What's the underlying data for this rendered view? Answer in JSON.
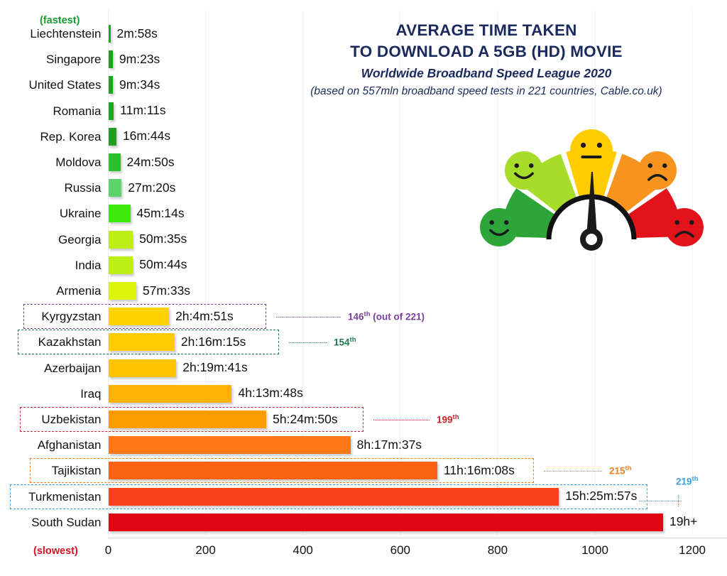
{
  "header": {
    "title_line1": "AVERAGE TIME TAKEN",
    "title_line2": "TO DOWNLOAD A 5GB (HD) MOVIE",
    "subtitle": "Worldwide Broadband Speed League 2020",
    "source": "(based on 557mln broadband speed tests in 221 countries, Cable.co.uk)",
    "title_color": "#1b2a5e"
  },
  "notes": {
    "fastest": "(fastest)",
    "fastest_color": "#1a9a33",
    "slowest": "(slowest)",
    "slowest_color": "#d81324"
  },
  "gauge": {
    "name": "speedometer-gauge",
    "segment_colors": [
      "#2ea539",
      "#a7dc2b",
      "#ffcc00",
      "#f79420",
      "#e3131c"
    ],
    "faces": [
      "happy-face-green",
      "smile-face-lightgreen",
      "neutral-face-yellow",
      "sad-face-orange",
      "very-sad-face-red"
    ],
    "face_colors": [
      "#2ea539",
      "#a7dc2b",
      "#ffcc00",
      "#f79420",
      "#e3131c"
    ],
    "needle_color": "#1a1a1a"
  },
  "chart_data": {
    "type": "bar",
    "orientation": "horizontal",
    "title": "AVERAGE TIME TAKEN TO DOWNLOAD A 5GB (HD) MOVIE",
    "subtitle": "Worldwide Broadband Speed League 2020",
    "xlabel": "",
    "ylabel": "",
    "xlim": [
      0,
      1200
    ],
    "xticks": [
      0,
      200,
      400,
      600,
      800,
      1000,
      1200
    ],
    "xtick_labels": [
      "0",
      "200",
      "400",
      "600",
      "800",
      "1000",
      "1200"
    ],
    "grid": true,
    "legend": "none",
    "unit": "minutes",
    "categories": [
      "Liechtenstein",
      "Singapore",
      "United States",
      "Romania",
      "Rep. Korea",
      "Moldova",
      "Russia",
      "Ukraine",
      "Georgia",
      "India",
      "Armenia",
      "Kyrgyzstan",
      "Kazakhstan",
      "Azerbaijan",
      "Iraq",
      "Uzbekistan",
      "Afghanistan",
      "Tajikistan",
      "Turkmenistan",
      "South Sudan"
    ],
    "values": [
      2.97,
      9.38,
      9.57,
      11.18,
      16.73,
      24.83,
      27.33,
      45.23,
      50.58,
      50.73,
      57.55,
      124.85,
      136.25,
      139.68,
      253.8,
      324.83,
      497.62,
      676.13,
      925.95,
      1140
    ],
    "value_labels": [
      "2m:58s",
      "9m:23s",
      "9m:34s",
      "11m:11s",
      "16m:44s",
      "24m:50s",
      "27m:20s",
      "45m:14s",
      "50m:35s",
      "50m:44s",
      "57m:33s",
      "2h:4m:51s",
      "2h:16m:15s",
      "2h:19m:41s",
      "4h:13m:48s",
      "5h:24m:50s",
      "8h:17m:37s",
      "11h:16m:08s",
      "15h:25m:57s",
      "19h+"
    ],
    "bar_colors": [
      "#17a81a",
      "#17a81a",
      "#17a81a",
      "#1ca81c",
      "#1f9e22",
      "#2cc22e",
      "#5ed16a",
      "#3ae80a",
      "#bdee18",
      "#bdee18",
      "#ddf40e",
      "#ffd300",
      "#ffcc00",
      "#ffc400",
      "#ffb300",
      "#ff9d00",
      "#ff7a16",
      "#fc6213",
      "#f9411a",
      "#e00714"
    ]
  },
  "highlights": [
    {
      "category": "Kyrgyzstan",
      "rank": "146",
      "suffix": "th",
      "extra": " (out of 221)",
      "color": "#7b3fa0"
    },
    {
      "category": "Kazakhstan",
      "rank": "154",
      "suffix": "th",
      "extra": "",
      "color": "#1f7a4d"
    },
    {
      "category": "Uzbekistan",
      "rank": "199",
      "suffix": "th",
      "extra": "",
      "color": "#c1272d"
    },
    {
      "category": "Tajikistan",
      "rank": "215",
      "suffix": "th",
      "extra": "",
      "color": "#f07f1a"
    },
    {
      "category": "Turkmenistan",
      "rank": "219",
      "suffix": "th",
      "extra": "",
      "color": "#3e9fe0"
    }
  ]
}
